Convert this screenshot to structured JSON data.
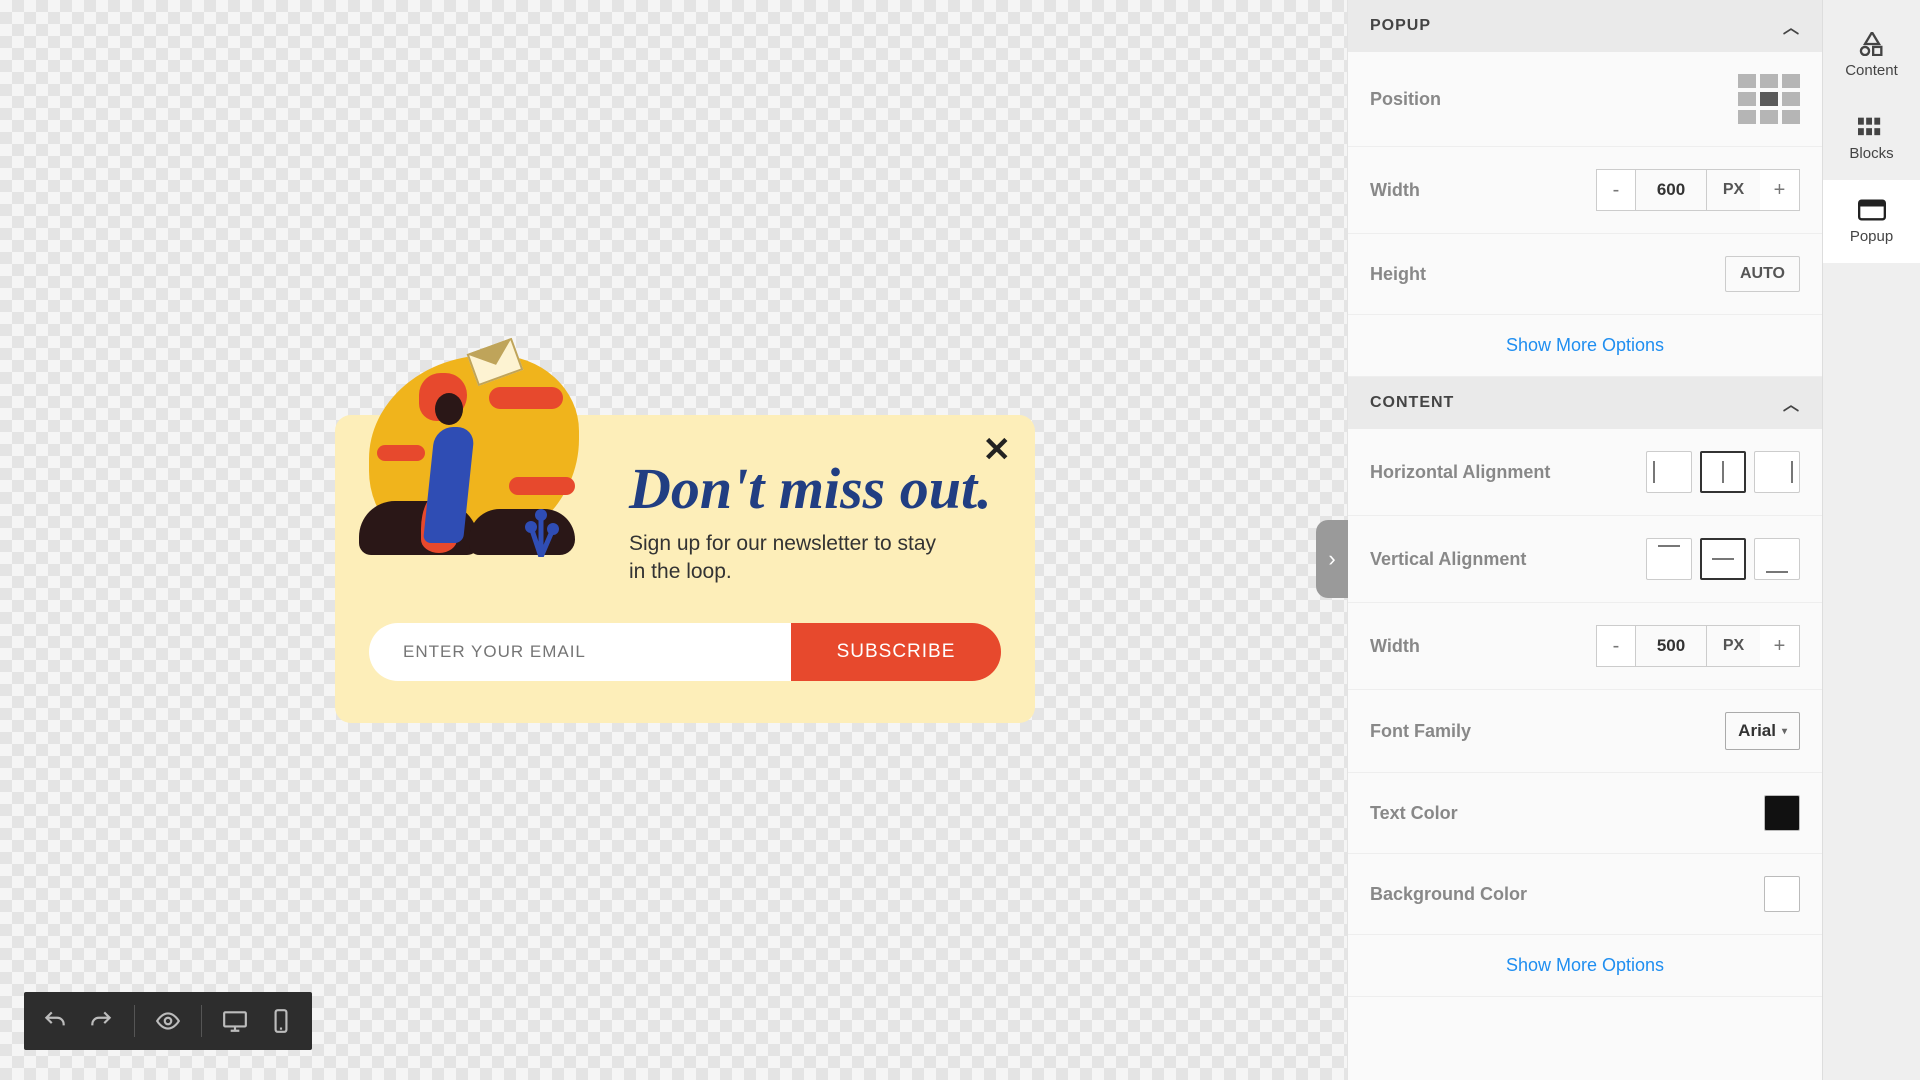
{
  "canvas": {
    "popup": {
      "title": "Don't miss out.",
      "subtitle": "Sign up for our newsletter to stay in the loop.",
      "email_placeholder": "ENTER YOUR EMAIL",
      "subscribe_label": "SUBSCRIBE"
    }
  },
  "panel": {
    "sections": {
      "popup": {
        "title": "POPUP",
        "position_label": "Position",
        "width_label": "Width",
        "width_value": "600",
        "width_unit": "PX",
        "height_label": "Height",
        "height_value": "AUTO",
        "more": "Show More Options"
      },
      "content": {
        "title": "CONTENT",
        "halign_label": "Horizontal Alignment",
        "valign_label": "Vertical Alignment",
        "width_label": "Width",
        "width_value": "500",
        "width_unit": "PX",
        "font_label": "Font Family",
        "font_value": "Arial",
        "text_color_label": "Text Color",
        "text_color": "#111111",
        "bg_color_label": "Background Color",
        "bg_color": "#ffffff",
        "more": "Show More Options"
      }
    }
  },
  "rail": {
    "content": "Content",
    "blocks": "Blocks",
    "popup": "Popup"
  },
  "stepper": {
    "minus": "-",
    "plus": "+"
  }
}
